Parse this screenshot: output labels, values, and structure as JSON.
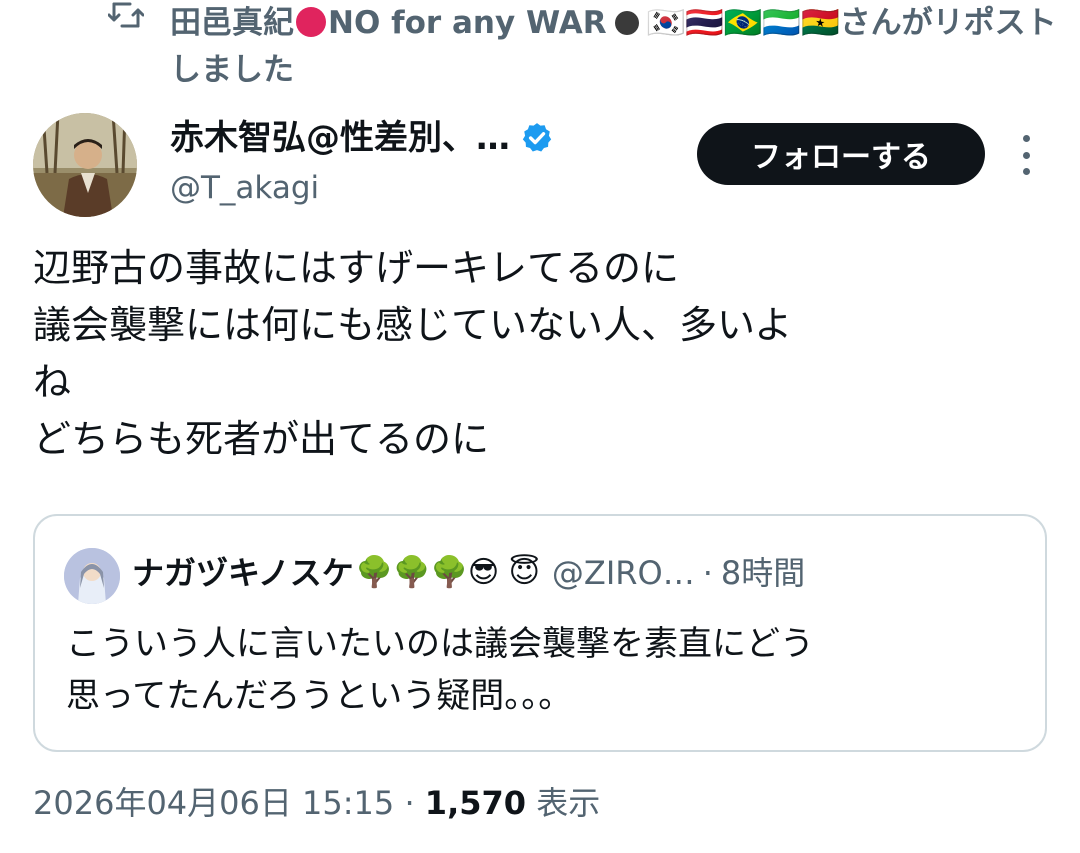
{
  "repost": {
    "icon": "repost-icon",
    "reposter_name": "田邑真紀",
    "reposter_rest": "NO for any WAR",
    "flags": "🇰🇷🇹🇭🇧🇷🇸🇱🇬🇭",
    "suffix": "さんがリポストしました"
  },
  "author": {
    "display_name": "赤木智弘@性差別、…",
    "handle": "@T_akagi",
    "verified_icon": "verified-badge-icon",
    "follow_label": "フォローする",
    "more_icon": "more-options-icon"
  },
  "tweet": {
    "lines": [
      "辺野古の事故にはすげーキレてるのに",
      "議会襲撃には何にも感じていない人、多いよ",
      "ね",
      "どちらも死者が出てるのに"
    ]
  },
  "quote": {
    "name": "ナガヅキノスケ",
    "emojis": "🌳🌳🌳😎 😇",
    "handle": "@ZIRO…",
    "dot": "·",
    "time": "8時間",
    "lines": [
      "こういう人に言いたいのは議会襲撃を素直にどう",
      "思ってたんだろうという疑問。。。"
    ]
  },
  "meta": {
    "timestamp": "2026年04月06日 15:15",
    "separator": "·",
    "views_count": "1,570",
    "views_label": "表示"
  },
  "colors": {
    "text_primary": "#0f1419",
    "text_secondary": "#536471",
    "verified_blue": "#1d9bf0",
    "border": "#cfd9de",
    "button_bg": "#0f1419"
  }
}
